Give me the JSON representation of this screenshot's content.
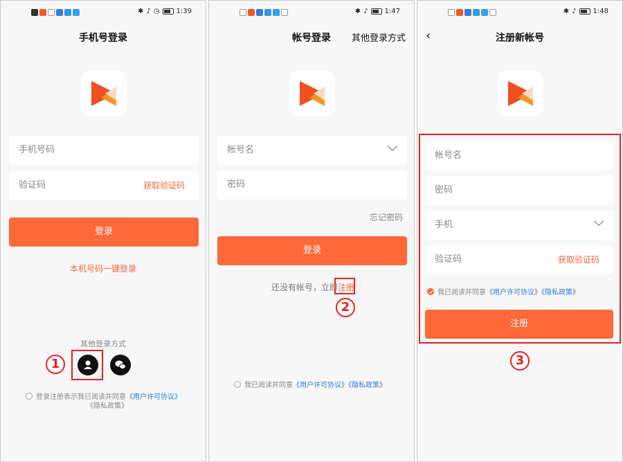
{
  "colors": {
    "accent": "#ff6838",
    "link": "#2f7bd8",
    "highlight": "#e52222"
  },
  "panel1": {
    "time": "1:39",
    "title": "手机号登录",
    "phone_placeholder": "手机号码",
    "code_placeholder": "验证码",
    "get_code": "获取验证码",
    "login_button": "登录",
    "one_click_login": "本机号码一键登录",
    "other_methods": "其他登录方式",
    "agreement_prefix": "登录注册表示我已阅读并同意",
    "user_agreement": "《用户许可协议》",
    "privacy_policy": "《隐私政策》",
    "marker": "1"
  },
  "panel2": {
    "time": "1:47",
    "title": "帐号登录",
    "other_methods": "其他登录方式",
    "account_placeholder": "帐号名",
    "password_placeholder": "密码",
    "forgot_password": "忘记密码",
    "login_button": "登录",
    "no_account_text": "还没有帐号，立即",
    "register_link": "注册",
    "agreement_prefix": "我已阅读并同意",
    "user_agreement": "《用户许可协议》",
    "privacy_policy": "《隐私政策》",
    "marker": "2"
  },
  "panel3": {
    "time": "1:48",
    "back_icon": "‹",
    "title": "注册新帐号",
    "account_placeholder": "帐号名",
    "password_placeholder": "密码",
    "phone_placeholder": "手机",
    "code_placeholder": "验证码",
    "get_code": "获取验证码",
    "agreement_prefix": "我已阅读并同意",
    "user_agreement": "《用户许可协议》",
    "privacy_policy": "《隐私政策》",
    "register_button": "注册",
    "marker": "3"
  }
}
